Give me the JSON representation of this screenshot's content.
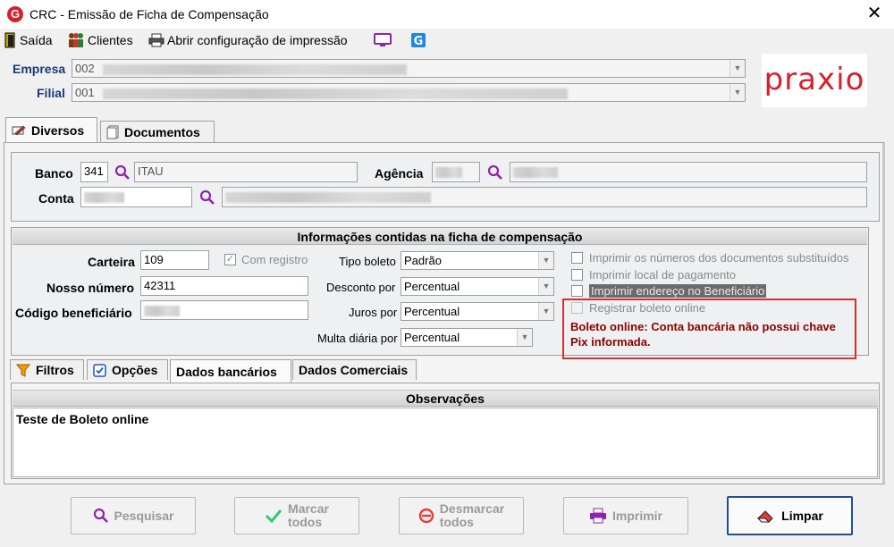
{
  "window": {
    "title": "CRC - Emissão de Ficha de Compensação",
    "app_icon_letter": "G"
  },
  "toolbar": {
    "exit": "Saída",
    "clients": "Clientes",
    "print_config": "Abrir configuração de impressão"
  },
  "header": {
    "empresa_label": "Empresa",
    "empresa_value": "002",
    "filial_label": "Filial",
    "filial_value": "001",
    "logo_text": "praxio",
    "logo_color": "#d8202a"
  },
  "top_tabs": [
    "Diversos",
    "Documentos"
  ],
  "bank": {
    "banco_label": "Banco",
    "banco_code": "341",
    "banco_name": "ITAU",
    "agencia_label": "Agência",
    "conta_label": "Conta"
  },
  "info": {
    "section_title": "Informações contidas na ficha de compensação",
    "carteira_label": "Carteira",
    "carteira_value": "109",
    "com_registro": "Com registro",
    "nosso_numero_label": "Nosso número",
    "nosso_numero_value": "42311",
    "codigo_label": "Código beneficiário",
    "tipo_boleto_label": "Tipo boleto",
    "tipo_boleto_value": "Padrão",
    "desconto_label": "Desconto por",
    "desconto_value": "Percentual",
    "juros_label": "Juros por",
    "juros_value": "Percentual",
    "multa_label": "Multa diária por",
    "multa_value": "Percentual",
    "opt1": "Imprimir os números dos documentos substituídos",
    "opt2": "Imprimir local de pagamento",
    "opt3": "Imprimir endereço no Beneficiário",
    "opt4": "Registrar boleto online",
    "warning": "Boleto online: Conta bancária não possui chave Pix informada.",
    "warning_color": "#8b0000"
  },
  "bottom_tabs": [
    "Filtros",
    "Opções",
    "Dados bancários",
    "Dados Comerciais"
  ],
  "obs": {
    "title": "Observações",
    "text": "Teste de Boleto online"
  },
  "buttons": {
    "pesquisar": "Pesquisar",
    "marcar_1": "Marcar",
    "marcar_2": "todos",
    "desmarcar_1": "Desmarcar",
    "desmarcar_2": "todos",
    "imprimir": "Imprimir",
    "limpar": "Limpar"
  }
}
